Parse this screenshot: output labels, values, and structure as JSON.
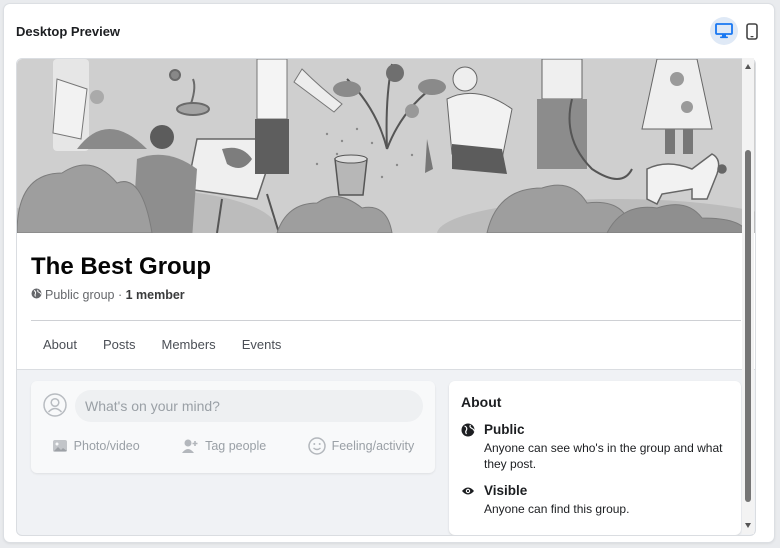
{
  "panel": {
    "title": "Desktop Preview"
  },
  "preview_modes": [
    {
      "name": "desktop",
      "icon": "desktop-icon",
      "selected": true
    },
    {
      "name": "mobile",
      "icon": "mobile-phone-icon",
      "selected": false
    }
  ],
  "group": {
    "name": "The Best Group",
    "privacy": "Public group",
    "separator": " · ",
    "member_count": "1 member",
    "tabs": [
      "About",
      "Posts",
      "Members",
      "Events"
    ]
  },
  "composer": {
    "placeholder": "What's on your mind?",
    "actions": [
      {
        "label": "Photo/video",
        "icon": "photo-icon"
      },
      {
        "label": "Tag people",
        "icon": "tag-people-icon"
      },
      {
        "label": "Feeling/activity",
        "icon": "smiley-icon"
      }
    ]
  },
  "about": {
    "title": "About",
    "items": [
      {
        "title": "Public",
        "description": "Anyone can see who's in the group and what they post.",
        "icon": "globe-icon"
      },
      {
        "title": "Visible",
        "description": "Anyone can find this group.",
        "icon": "eye-icon"
      }
    ]
  },
  "colors": {
    "accent": "#1877f2",
    "cover_gray": "#d4d4d4"
  }
}
